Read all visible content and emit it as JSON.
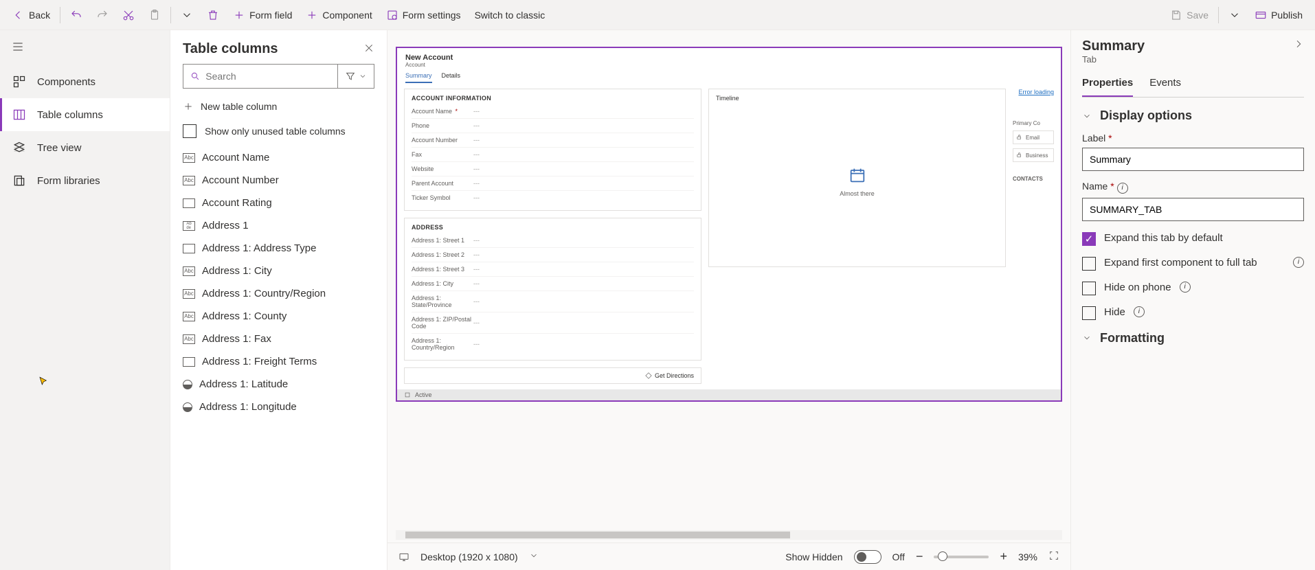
{
  "toolbar": {
    "back": "Back",
    "form_field": "Form field",
    "component": "Component",
    "form_settings": "Form settings",
    "switch_classic": "Switch to classic",
    "save": "Save",
    "publish": "Publish"
  },
  "rail": {
    "components": "Components",
    "table_columns": "Table columns",
    "tree_view": "Tree view",
    "form_libraries": "Form libraries"
  },
  "tcol": {
    "title": "Table columns",
    "search_placeholder": "Search",
    "new_column": "New table column",
    "show_unused": "Show only unused table columns",
    "items": [
      {
        "label": "Account Name",
        "type": "Abc"
      },
      {
        "label": "Account Number",
        "type": "Abc"
      },
      {
        "label": "Account Rating",
        "type": "rect"
      },
      {
        "label": "Address 1",
        "type": "Abcdef"
      },
      {
        "label": "Address 1: Address Type",
        "type": "rect"
      },
      {
        "label": "Address 1: City",
        "type": "Abc"
      },
      {
        "label": "Address 1: Country/Region",
        "type": "Abc"
      },
      {
        "label": "Address 1: County",
        "type": "Abc"
      },
      {
        "label": "Address 1: Fax",
        "type": "Abc"
      },
      {
        "label": "Address 1: Freight Terms",
        "type": "rect"
      },
      {
        "label": "Address 1: Latitude",
        "type": "circle"
      },
      {
        "label": "Address 1: Longitude",
        "type": "circle"
      }
    ]
  },
  "form": {
    "title": "New Account",
    "subtitle": "Account",
    "tabs": [
      "Summary",
      "Details"
    ],
    "section1": {
      "heading": "ACCOUNT INFORMATION",
      "fields": [
        {
          "label": "Account Name",
          "required": true
        },
        {
          "label": "Phone"
        },
        {
          "label": "Account Number"
        },
        {
          "label": "Fax"
        },
        {
          "label": "Website"
        },
        {
          "label": "Parent Account"
        },
        {
          "label": "Ticker Symbol"
        }
      ]
    },
    "section2": {
      "heading": "ADDRESS",
      "fields": [
        {
          "label": "Address 1: Street 1"
        },
        {
          "label": "Address 1: Street 2"
        },
        {
          "label": "Address 1: Street 3"
        },
        {
          "label": "Address 1: City"
        },
        {
          "label": "Address 1: State/Province"
        },
        {
          "label": "Address 1: ZIP/Postal Code"
        },
        {
          "label": "Address 1: Country/Region"
        }
      ]
    },
    "timeline": "Timeline",
    "almost_there": "Almost there",
    "error_loading": "Error loading",
    "get_directions": "Get Directions",
    "footer_status": "Active",
    "side": {
      "primary": "Primary Co",
      "email": "Email",
      "business": "Business",
      "contacts": "CONTACTS"
    }
  },
  "status_bar": {
    "device": "Desktop (1920 x 1080)",
    "show_hidden": "Show Hidden",
    "toggle_state": "Off",
    "zoom": "39%"
  },
  "props": {
    "title": "Summary",
    "subtitle": "Tab",
    "tabs": [
      "Properties",
      "Events"
    ],
    "display_options": "Display options",
    "label_lbl": "Label",
    "label_val": "Summary",
    "name_lbl": "Name",
    "name_val": "SUMMARY_TAB",
    "expand_default": "Expand this tab by default",
    "expand_first": "Expand first component to full tab",
    "hide_phone": "Hide on phone",
    "hide": "Hide",
    "formatting": "Formatting"
  }
}
